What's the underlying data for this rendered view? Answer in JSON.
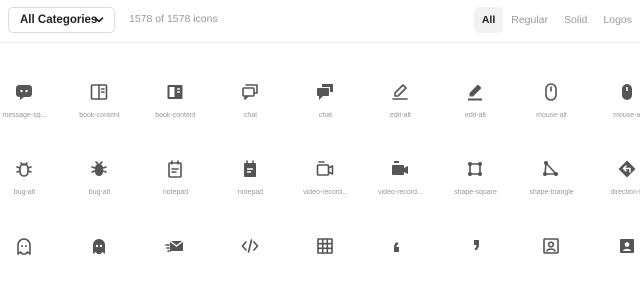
{
  "toolbar": {
    "category_label": "All Categories",
    "count_text": "1578 of 1578 icons",
    "filters": [
      {
        "label": "All",
        "active": true
      },
      {
        "label": "Regular",
        "active": false
      },
      {
        "label": "Solid",
        "active": false
      },
      {
        "label": "Logos",
        "active": false
      }
    ]
  },
  "colors": {
    "icon": "#555555",
    "label": "#9a9a9a",
    "active_filter_bg": "#f2f2f2"
  },
  "icons": [
    [
      {
        "label": "message-sq...",
        "icon": "message-square-dots-solid-icon"
      },
      {
        "label": "book-content",
        "icon": "book-content-regular-icon"
      },
      {
        "label": "book-content",
        "icon": "book-content-solid-icon"
      },
      {
        "label": "chat",
        "icon": "chat-regular-icon"
      },
      {
        "label": "chat",
        "icon": "chat-solid-icon"
      },
      {
        "label": "edit-alt",
        "icon": "edit-alt-regular-icon"
      },
      {
        "label": "edit-alt",
        "icon": "edit-alt-solid-icon"
      },
      {
        "label": "mouse-alt",
        "icon": "mouse-alt-regular-icon"
      },
      {
        "label": "mouse-al",
        "icon": "mouse-alt-solid-icon"
      }
    ],
    [
      {
        "label": "bug-alt",
        "icon": "bug-alt-regular-icon"
      },
      {
        "label": "bug-alt",
        "icon": "bug-alt-solid-icon"
      },
      {
        "label": "notepad",
        "icon": "notepad-regular-icon"
      },
      {
        "label": "notepad",
        "icon": "notepad-solid-icon"
      },
      {
        "label": "video-record...",
        "icon": "video-recording-regular-icon"
      },
      {
        "label": "video-record...",
        "icon": "video-recording-solid-icon"
      },
      {
        "label": "shape-square",
        "icon": "shape-square-icon"
      },
      {
        "label": "shape-triangle",
        "icon": "shape-triangle-icon"
      },
      {
        "label": "direction-le",
        "icon": "direction-left-solid-icon"
      }
    ],
    [
      {
        "label": "",
        "icon": "ghost-regular-icon"
      },
      {
        "label": "",
        "icon": "ghost-solid-icon"
      },
      {
        "label": "",
        "icon": "mail-send-icon"
      },
      {
        "label": "",
        "icon": "code-alt-icon"
      },
      {
        "label": "",
        "icon": "grid-icon"
      },
      {
        "label": "",
        "icon": "quote-left-icon"
      },
      {
        "label": "",
        "icon": "quote-right-icon"
      },
      {
        "label": "",
        "icon": "user-square-regular-icon"
      },
      {
        "label": "",
        "icon": "user-square-solid-icon"
      }
    ]
  ]
}
